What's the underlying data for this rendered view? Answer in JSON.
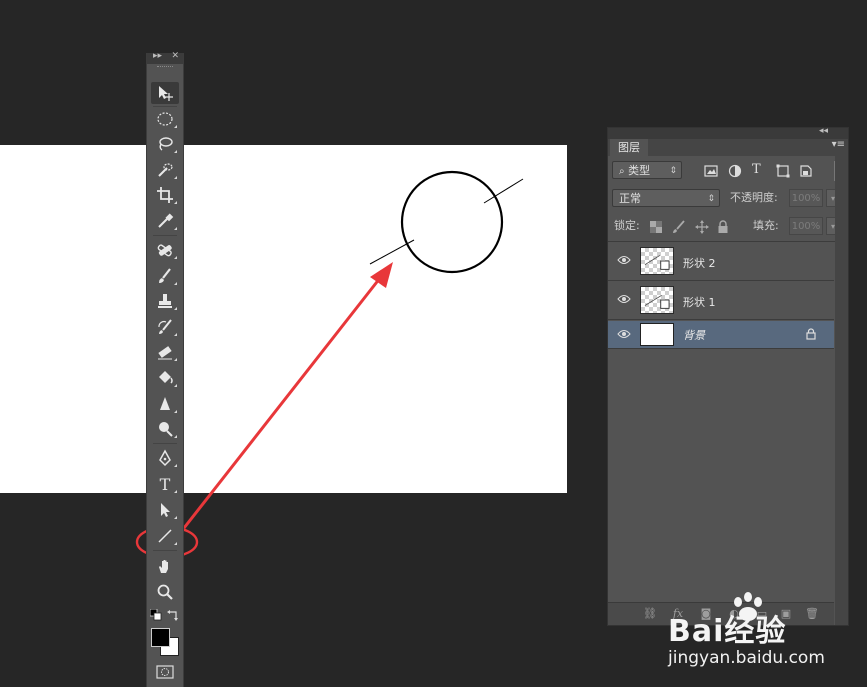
{
  "toolbar": {
    "header_left": "▸▸",
    "header_close": "✕",
    "tools": [
      {
        "icon": "move-tool-icon",
        "active": true
      },
      {
        "icon": "elliptical-marquee-icon"
      },
      {
        "icon": "lasso-icon"
      },
      {
        "icon": "quick-selection-icon"
      },
      {
        "icon": "crop-icon"
      },
      {
        "icon": "eyedropper-icon"
      },
      {
        "icon": "healing-brush-icon"
      },
      {
        "icon": "brush-icon"
      },
      {
        "icon": "clone-stamp-icon"
      },
      {
        "icon": "history-brush-icon"
      },
      {
        "icon": "eraser-icon"
      },
      {
        "icon": "paint-bucket-icon"
      },
      {
        "icon": "blur-icon"
      },
      {
        "icon": "dodge-icon"
      },
      {
        "icon": "pen-icon"
      },
      {
        "icon": "type-icon",
        "label": "T"
      },
      {
        "icon": "path-selection-icon"
      },
      {
        "icon": "line-tool-icon",
        "highlighted": true
      },
      {
        "icon": "hand-icon"
      },
      {
        "icon": "zoom-icon"
      }
    ],
    "foreground_color": "#000000",
    "background_color": "#ffffff"
  },
  "layers_panel": {
    "tab_label": "图层",
    "filter_label": "类型",
    "blend_mode": "正常",
    "opacity_label": "不透明度:",
    "opacity_value": "100%",
    "lock_label": "锁定:",
    "fill_label": "填充:",
    "fill_value": "100%",
    "layers": [
      {
        "name": "形状 2",
        "selected": false
      },
      {
        "name": "形状 1",
        "selected": false
      },
      {
        "name": "背景",
        "selected": true,
        "locked": true
      }
    ],
    "footer_fx": "fx"
  },
  "annotation": {
    "color": "#e8373a"
  },
  "watermark": {
    "brand": "Bai经验",
    "url": "jingyan.baidu.com"
  }
}
